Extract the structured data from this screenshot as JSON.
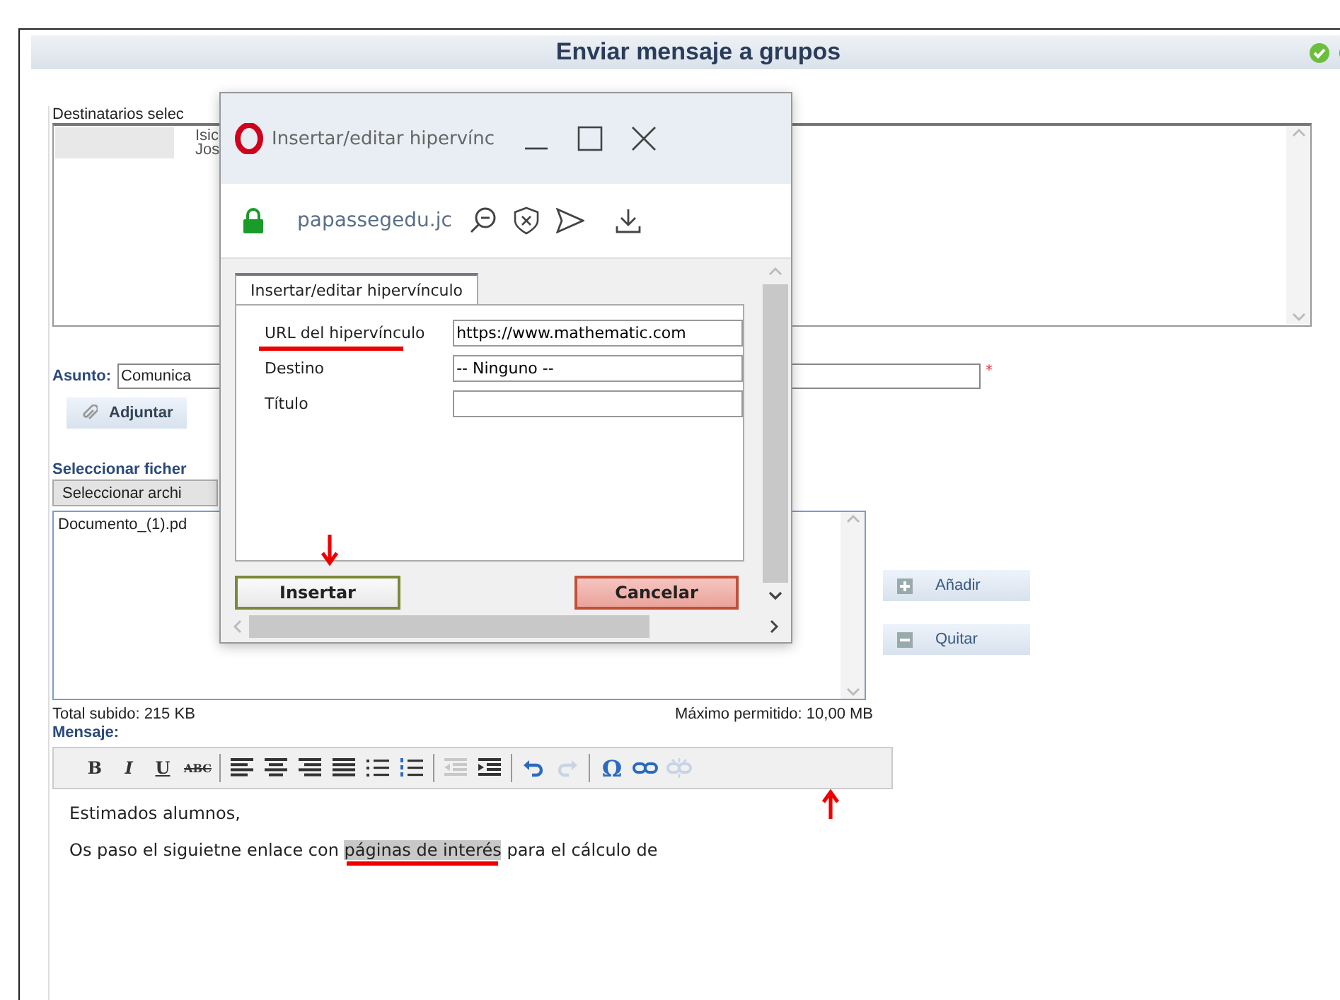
{
  "header": {
    "title": "Enviar mensaje a grupos"
  },
  "recipients": {
    "label": "Destinatarios selec",
    "names": [
      "Isic",
      "Jos"
    ]
  },
  "subject": {
    "label": "Asunto:",
    "value": "Comunica",
    "required_mark": "*"
  },
  "attach_button": "Adjuntar",
  "files": {
    "label": "Seleccionar ficher",
    "select_button": "Seleccionar archi",
    "items": [
      "Documento_(1).pd"
    ],
    "add_button": "Añadir",
    "remove_button": "Quitar",
    "total": "Total subido: 215 KB",
    "max": "Máximo permitido: 10,00 MB"
  },
  "message": {
    "label": "Mensaje:",
    "toolbar": [
      {
        "kind": "bold",
        "label": "B",
        "disabled": false
      },
      {
        "kind": "italic",
        "label": "I",
        "disabled": false
      },
      {
        "kind": "underline",
        "label": "U",
        "disabled": false
      },
      {
        "kind": "strike",
        "label": "ABC",
        "disabled": false
      },
      {
        "kind": "separator"
      },
      {
        "kind": "align-left",
        "disabled": false
      },
      {
        "kind": "align-center",
        "disabled": false
      },
      {
        "kind": "align-right",
        "disabled": false
      },
      {
        "kind": "align-justify",
        "disabled": false
      },
      {
        "kind": "bullet-list",
        "disabled": false
      },
      {
        "kind": "numbered-list",
        "disabled": false
      },
      {
        "kind": "separator"
      },
      {
        "kind": "outdent",
        "disabled": true
      },
      {
        "kind": "indent",
        "disabled": false
      },
      {
        "kind": "separator"
      },
      {
        "kind": "undo",
        "disabled": false
      },
      {
        "kind": "redo",
        "disabled": true
      },
      {
        "kind": "separator"
      },
      {
        "kind": "special",
        "label": "Ω",
        "disabled": false
      },
      {
        "kind": "link",
        "disabled": false
      },
      {
        "kind": "unlink",
        "disabled": true
      }
    ],
    "lines": [
      {
        "text": "Estimados alumnos,"
      },
      {
        "text": "Os paso el siguietne enlace con ",
        "selection": "páginas de interés",
        "after": " para el cálculo de"
      }
    ]
  },
  "dialog": {
    "title": "Insertar/editar hipervínc",
    "address": "papassegedu.jc",
    "tab": {
      "label": "Insertar/editar hipervínculo",
      "selected": true
    },
    "fields": [
      {
        "label": "URL del hipervínculo",
        "value": "https://www.mathematic.com"
      },
      {
        "label": "Destino",
        "value": "-- Ninguno --"
      },
      {
        "label": "Título"
      }
    ],
    "insert_button": "Insertar",
    "cancel_button": "Cancelar"
  }
}
